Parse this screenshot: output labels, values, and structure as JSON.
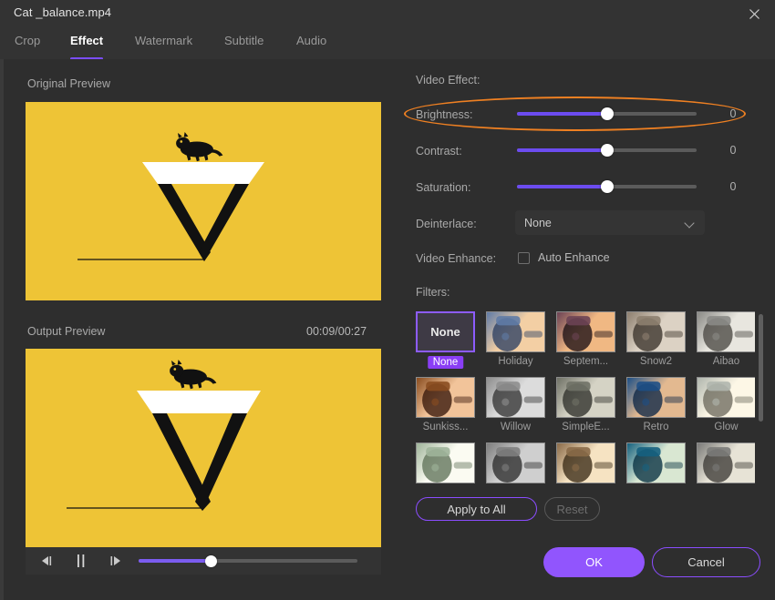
{
  "window": {
    "title": "Cat _balance.mp4",
    "close_icon": "close-icon"
  },
  "tabs": [
    {
      "label": "Crop",
      "active": false
    },
    {
      "label": "Effect",
      "active": true
    },
    {
      "label": "Watermark",
      "active": false
    },
    {
      "label": "Subtitle",
      "active": false
    },
    {
      "label": "Audio",
      "active": false
    }
  ],
  "preview": {
    "original_label": "Original Preview",
    "output_label": "Output Preview",
    "timecode": "00:09/00:27",
    "background_color": "#eec436",
    "player": {
      "prev_frame_icon": "previous-frame-icon",
      "pause_icon": "pause-icon",
      "next_frame_icon": "next-frame-icon",
      "progress_percent": 33
    }
  },
  "effect_panel": {
    "heading": "Video Effect:",
    "sliders": [
      {
        "label": "Brightness:",
        "value": "0",
        "percent": 50,
        "highlighted": true
      },
      {
        "label": "Contrast:",
        "value": "0",
        "percent": 50,
        "highlighted": false
      },
      {
        "label": "Saturation:",
        "value": "0",
        "percent": 50,
        "highlighted": false
      }
    ],
    "deinterlace": {
      "label": "Deinterlace:",
      "selected": "None",
      "chevron_icon": "chevron-down-icon"
    },
    "video_enhance": {
      "label": "Video Enhance:",
      "checkbox_label": "Auto Enhance",
      "checked": false
    },
    "filters": {
      "label": "Filters:",
      "items": [
        {
          "name": "None",
          "selected": true,
          "kind": "none"
        },
        {
          "name": "Holiday",
          "selected": false,
          "kind": "image",
          "c1": "#5f7ba6",
          "c2": "#f3cfa4",
          "c3": "#2b3f63"
        },
        {
          "name": "Septem...",
          "selected": false,
          "kind": "image",
          "c1": "#6b4254",
          "c2": "#f0b883",
          "c3": "#1b1014"
        },
        {
          "name": "Snow2",
          "selected": false,
          "kind": "image",
          "c1": "#8d7f6f",
          "c2": "#dcd2c4",
          "c3": "#3a322a"
        },
        {
          "name": "Aibao",
          "selected": false,
          "kind": "image",
          "c1": "#8a8a86",
          "c2": "#e8e6df",
          "c3": "#4a4843"
        },
        {
          "name": "Sunkiss...",
          "selected": false,
          "kind": "image",
          "c1": "#8a4d20",
          "c2": "#f2c49a",
          "c3": "#37170a"
        },
        {
          "name": "Willow",
          "selected": false,
          "kind": "image",
          "c1": "#8e8e8e",
          "c2": "#dcdcdc",
          "c3": "#333333"
        },
        {
          "name": "SimpleE...",
          "selected": false,
          "kind": "image",
          "c1": "#6f7166",
          "c2": "#d5d3c5",
          "c3": "#2e2f2a"
        },
        {
          "name": "Retro",
          "selected": false,
          "kind": "image",
          "c1": "#1d4f86",
          "c2": "#e3b990",
          "c3": "#0d2746"
        },
        {
          "name": "Glow",
          "selected": false,
          "kind": "image",
          "c1": "#b0b6ae",
          "c2": "#fdf7e6",
          "c3": "#6d6a5e"
        },
        {
          "name": "",
          "selected": false,
          "kind": "image",
          "c1": "#9fb49a",
          "c2": "#fbfbf2",
          "c3": "#5f7258"
        },
        {
          "name": "",
          "selected": false,
          "kind": "image",
          "c1": "#7e7e7e",
          "c2": "#cfcfcf",
          "c3": "#2c2c2c"
        },
        {
          "name": "",
          "selected": false,
          "kind": "image",
          "c1": "#8a6a48",
          "c2": "#f6e3c2",
          "c3": "#3a2a16"
        },
        {
          "name": "",
          "selected": false,
          "kind": "image",
          "c1": "#15617f",
          "c2": "#d9e7d2",
          "c3": "#073041"
        },
        {
          "name": "",
          "selected": false,
          "kind": "image",
          "c1": "#7a7a78",
          "c2": "#e7e3d6",
          "c3": "#3c3a36"
        }
      ]
    }
  },
  "buttons": {
    "apply_to_all": "Apply to All",
    "reset": "Reset",
    "ok": "OK",
    "cancel": "Cancel"
  },
  "colors": {
    "accent_purple": "#8b4dff",
    "ok_purple": "#9155fd",
    "highlight_orange": "#ef8022",
    "slider_purple": "#6c4cf0",
    "video_yellow": "#eec436"
  }
}
